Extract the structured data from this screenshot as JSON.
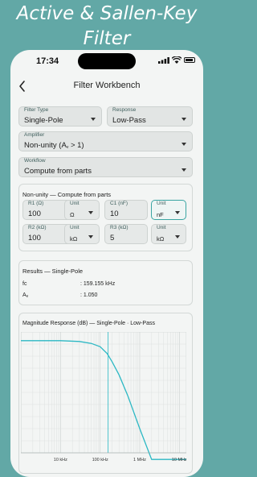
{
  "promo": {
    "title_line1": "Active & Sallen-Key",
    "title_line2": "Filter"
  },
  "status_bar": {
    "time": "17:34"
  },
  "nav": {
    "title": "Filter Workbench"
  },
  "selectors": {
    "filter_type": {
      "label": "Filter Type",
      "value": "Single-Pole"
    },
    "response": {
      "label": "Response",
      "value": "Low-Pass"
    },
    "amplifier": {
      "label": "Amplifier",
      "value_main": "Non-unity (A",
      "value_sub": "v",
      "value_tail": " > 1)"
    },
    "workflow": {
      "label": "Workflow",
      "value": "Compute from parts"
    }
  },
  "parts": {
    "title": "Non-unity — Compute from parts",
    "r1": {
      "label": "R1 (Ω)",
      "value": "100"
    },
    "r1_unit": {
      "label": "Unit",
      "value": "Ω"
    },
    "c1": {
      "label": "C1 (nF)",
      "value": "10"
    },
    "c1_unit": {
      "label": "Unit",
      "value": "nF"
    },
    "r2": {
      "label": "R2 (kΩ)",
      "value": "100"
    },
    "r2_unit": {
      "label": "Unit",
      "value": "kΩ"
    },
    "r3": {
      "label": "R3 (kΩ)",
      "value": "5"
    },
    "r3_unit": {
      "label": "Unit",
      "value": "kΩ"
    }
  },
  "results": {
    "title": "Results — Single-Pole",
    "rows": [
      {
        "name": "fc",
        "value": ":  159.155 kHz"
      },
      {
        "name_main": "A",
        "name_sub": "v",
        "value": ":  1.050"
      }
    ]
  },
  "chart_data": {
    "type": "line",
    "title": "Magnitude Response (dB) — Single-Pole · Low-Pass",
    "x_scale": "log",
    "xlim": [
      1000,
      15000000
    ],
    "x_tick_labels": [
      "10 kHz",
      "100 kHz",
      "1 MHz",
      "10 MHz"
    ],
    "x_ticks": [
      10000,
      100000,
      1000000,
      10000000
    ],
    "ylim": [
      -20,
      2
    ],
    "cutoff_marker_x": 159155,
    "series": [
      {
        "color": "#2cb8c4",
        "x": [
          1000,
          10000,
          30000,
          60000,
          100000,
          150000,
          200000,
          300000,
          500000,
          1000000,
          2000000,
          5000000,
          10000000,
          15000000
        ],
        "y": [
          0.42,
          0.41,
          0.27,
          -0.08,
          -0.68,
          -1.92,
          -3.4,
          -5.8,
          -9.6,
          -15.6,
          -21.5,
          -28.9,
          -34.9,
          -38.0
        ]
      }
    ]
  },
  "colors": {
    "accent": "#3aa5a2",
    "background": "#62a8a6",
    "curve": "#2cb8c4"
  }
}
